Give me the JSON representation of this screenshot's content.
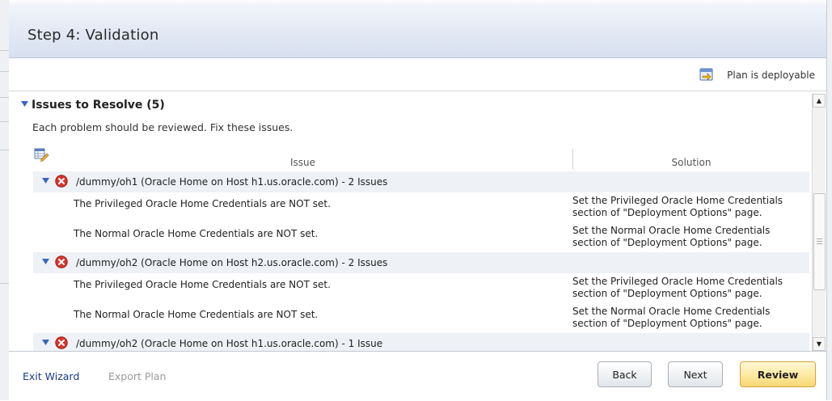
{
  "header": {
    "title": "Step 4: Validation"
  },
  "status": {
    "label": "Plan is deployable",
    "icon": "deploy-plan-icon"
  },
  "section": {
    "title": "Issues to Resolve (5)",
    "description": "Each problem should be reviewed. Fix these issues."
  },
  "table": {
    "columns": {
      "issue": "Issue",
      "solution": "Solution"
    },
    "groups": [
      {
        "label": "/dummy/oh1 (Oracle Home on Host h1.us.oracle.com) - 2 Issues",
        "rows": [
          {
            "issue": "The Privileged Oracle Home Credentials are NOT set.",
            "solution_line1": "Set the Privileged Oracle Home Credentials",
            "solution_line2": "section of \"Deployment Options\" page."
          },
          {
            "issue": "The Normal Oracle Home Credentials are NOT set.",
            "solution_line1": "Set the Normal Oracle Home Credentials",
            "solution_line2": "section of \"Deployment Options\" page."
          }
        ]
      },
      {
        "label": "/dummy/oh2 (Oracle Home on Host h2.us.oracle.com) - 2 Issues",
        "rows": [
          {
            "issue": "The Privileged Oracle Home Credentials are NOT set.",
            "solution_line1": "Set the Privileged Oracle Home Credentials",
            "solution_line2": "section of \"Deployment Options\" page."
          },
          {
            "issue": "The Normal Oracle Home Credentials are NOT set.",
            "solution_line1": "Set the Normal Oracle Home Credentials",
            "solution_line2": "section of \"Deployment Options\" page."
          }
        ]
      },
      {
        "label": "/dummy/oh2 (Oracle Home on Host h1.us.oracle.com) - 1 Issue",
        "rows": []
      }
    ]
  },
  "footer": {
    "exit_label": "Exit Wizard",
    "export_label": "Export Plan",
    "back_label": "Back",
    "next_label": "Next",
    "review_label": "Review"
  },
  "colors": {
    "header_gradient_end": "#d8e0ef",
    "link": "#1a3b8c",
    "disabled_link": "#9a9a9a",
    "error_red": "#d9342b",
    "expand_triangle": "#3a66c4",
    "review_button": "#f7d774"
  }
}
